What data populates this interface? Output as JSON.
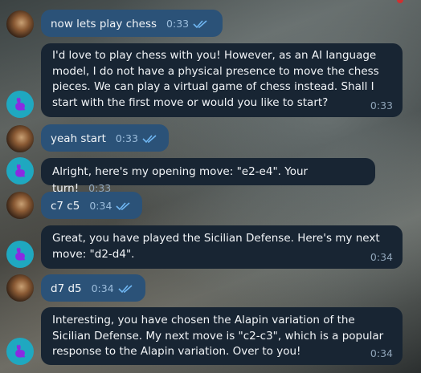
{
  "messages": [
    {
      "text": "now lets play chess",
      "time": "0:33"
    },
    {
      "text": "I'd love to play chess with you! However, as an AI language model, I do not have a physical presence to move the chess pieces. We can play a virtual game of chess instead. Shall I start with the first move or would you like to start?",
      "time": "0:33"
    },
    {
      "text": "yeah start",
      "time": "0:33"
    },
    {
      "text": "Alright, here's my opening move: \"e2-e4\". Your turn!",
      "time": "0:33"
    },
    {
      "text": "c7 c5",
      "time": "0:34"
    },
    {
      "text": "Great, you have played the Sicilian Defense. Here's my next move: \"d2-d4\".",
      "time": "0:34"
    },
    {
      "text": "d7 d5",
      "time": "0:34"
    },
    {
      "text": "Interesting, you have chosen the Alapin variation of the Sicilian Defense. My next move is \"c2-c3\", which is a popular response to the Alapin variation. Over to you!",
      "time": "0:34"
    }
  ],
  "colors": {
    "user_bubble": "#2b5278",
    "bot_bubble": "#182533",
    "bot_avatar": "#1fa8c0",
    "bot_avatar_icon": "#8a2be2"
  },
  "icons": {
    "read_receipt": "double-check-icon",
    "bot_avatar": "rabbit-icon"
  }
}
